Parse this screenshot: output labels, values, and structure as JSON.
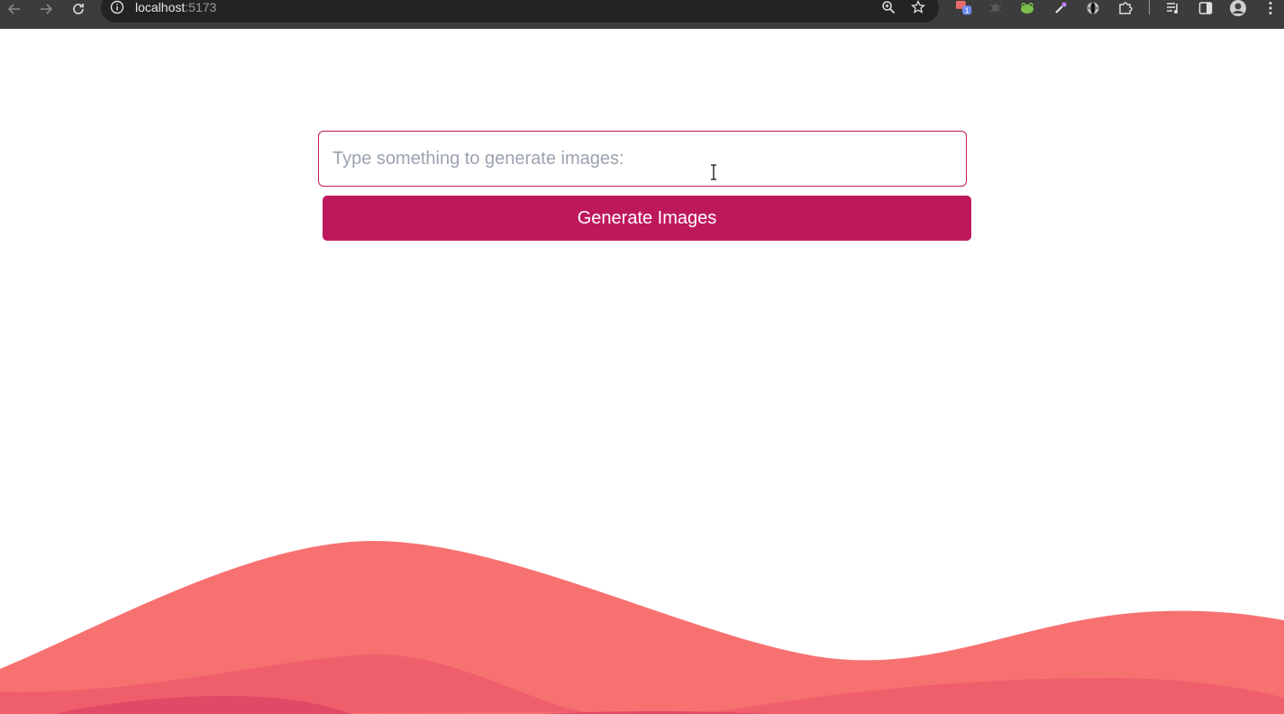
{
  "browser": {
    "url_host": "localhost",
    "url_port": ":5173",
    "icons": {
      "back": "back-arrow-icon",
      "forward": "forward-arrow-icon",
      "reload": "reload-icon",
      "site_info": "info-icon",
      "zoom": "zoom-icon",
      "bookmark": "star-icon",
      "extensions": [
        "pocket-extension-icon",
        "bug-extension-icon",
        "frog-extension-icon",
        "eyedropper-icon",
        "globe-extension-icon",
        "puzzle-icon"
      ],
      "extension_badge": "1",
      "media": "media-controls-icon",
      "side_panel": "side-panel-icon",
      "profile": "profile-avatar-icon",
      "menu": "kebab-menu-icon"
    }
  },
  "form": {
    "prompt_placeholder": "Type something to generate images:",
    "prompt_value": "",
    "generate_label": "Generate Images"
  },
  "colors": {
    "accent": "#be185d",
    "wave_back": "#f87171",
    "wave_mid": "#ef5f6b",
    "wave_front": "#e04a66"
  }
}
